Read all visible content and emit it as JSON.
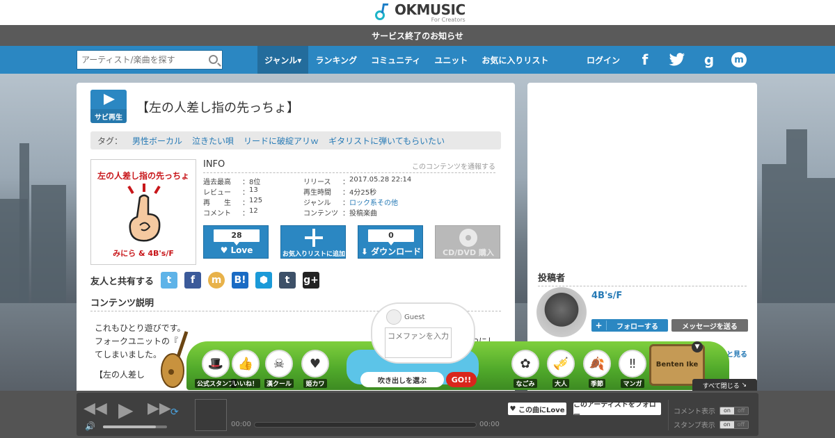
{
  "brand": {
    "name": "OKMUSIC",
    "tagline": "For Creators"
  },
  "notice": "サービス終了のお知らせ",
  "search": {
    "placeholder": "アーティスト/楽曲を探す"
  },
  "nav": {
    "items": [
      "ジャンル▾",
      "ランキング",
      "コミュニティ",
      "ユニット",
      "お気に入りリスト"
    ],
    "login": "ログイン",
    "social": [
      "f",
      "t",
      "g",
      "m"
    ]
  },
  "song": {
    "play_label": "サビ再生",
    "title": "【左の人差し指の先っちょ】",
    "tags_label": "タグ：",
    "tags": [
      "男性ボーカル",
      "泣きたい唄",
      "リードに破綻アリｗ",
      "ギタリストに弾いてもらいたい"
    ],
    "jacket_title": "左の人差し指の先っちょ",
    "jacket_artist": "みにら & 4B's/F"
  },
  "info": {
    "heading": "INFO",
    "report": "このコンテンツを通報する",
    "rows": [
      {
        "k": "過去最高",
        "v": "8位"
      },
      {
        "k": "レビュー",
        "v": "13"
      },
      {
        "k": "再　　生",
        "v": "125"
      },
      {
        "k": "コメント",
        "v": "12"
      },
      {
        "k": "リリース",
        "v": "2017.05.28 22:14"
      },
      {
        "k": "再生時間",
        "v": "4分25秒"
      },
      {
        "k": "ジャンル",
        "v": "ロック系その他"
      },
      {
        "k": "コンテンツ",
        "v": "投稿楽曲"
      }
    ]
  },
  "actions": {
    "love_count": "28",
    "love_label": "Love",
    "fav_label": "お気入りリストに追加",
    "dl_count": "0",
    "dl_label": "ダウンロード",
    "cd_label": "CD/DVD 購入"
  },
  "share": {
    "label": "友人と共有する",
    "icons": [
      "t",
      "f",
      "m",
      "B!",
      "⬢",
      "t",
      "g+"
    ]
  },
  "description": {
    "heading": "コンテンツ説明",
    "line1": "これもひとり遊びです。",
    "line2": "フォークユニットの『",
    "line2_end": "やにし",
    "line3": "てしまいました。",
    "line4": "【左の人差し"
  },
  "poster": {
    "heading": "投稿者",
    "name": "4B's/F",
    "follow": "フォローする",
    "message": "メッセージを送る",
    "more": "もっと見る"
  },
  "stamps": {
    "guest": "Guest",
    "comment_placeholder": "コメファンを入力",
    "bubble_select": "吹き出しを選ぶ",
    "go": "GO!!",
    "left": [
      "公式スタンプ",
      "いいね！",
      "漢クール",
      "姫カワ"
    ],
    "right": [
      "なごみ",
      "大人",
      "季節",
      "マンガ"
    ],
    "sign": "Benten Ike",
    "close_all": "すべて閉じる"
  },
  "player": {
    "time_start": "00:00",
    "time_end": "00:00",
    "love_btn": "この曲にLove",
    "follow_btn": "このアーティストをフォロー",
    "comment_display": "コメント表示",
    "stamp_display": "スタンプ表示",
    "on": "on",
    "off": "off"
  }
}
